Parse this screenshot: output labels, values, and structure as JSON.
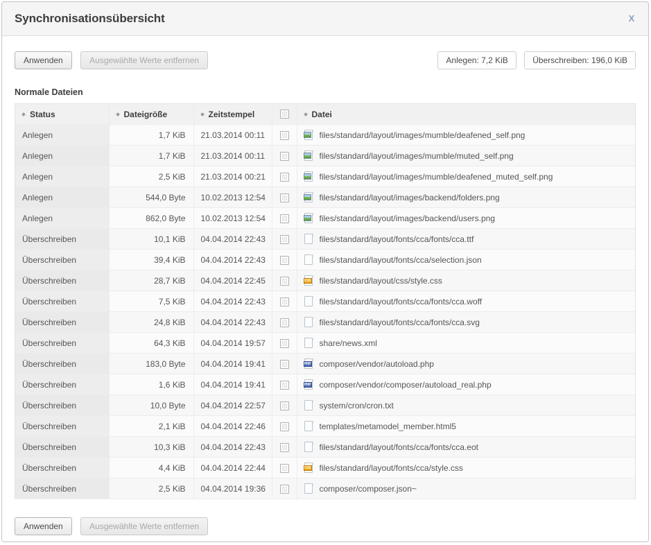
{
  "dialog": {
    "title": "Synchronisationsübersicht",
    "close_label": "X"
  },
  "toolbar": {
    "apply_label": "Anwenden",
    "remove_selected_label": "Ausgewählte Werte entfernen",
    "stat_create_label": "Anlegen: 7,2 KiB",
    "stat_overwrite_label": "Überschreiben: 196,0 KiB"
  },
  "section": {
    "title": "Normale Dateien"
  },
  "table": {
    "columns": [
      {
        "key": "status",
        "label": "Status"
      },
      {
        "key": "size",
        "label": "Dateigröße"
      },
      {
        "key": "time",
        "label": "Zeitstempel"
      },
      {
        "key": "check",
        "label": ""
      },
      {
        "key": "file",
        "label": "Datei"
      }
    ],
    "rows": [
      {
        "status": "Anlegen",
        "size": "1,7 KiB",
        "time": "21.03.2014 00:11",
        "checked": false,
        "icon": "image-file-icon",
        "file": "files/standard/layout/images/mumble/deafened_self.png"
      },
      {
        "status": "Anlegen",
        "size": "1,7 KiB",
        "time": "21.03.2014 00:11",
        "checked": false,
        "icon": "image-file-icon",
        "file": "files/standard/layout/images/mumble/muted_self.png"
      },
      {
        "status": "Anlegen",
        "size": "2,5 KiB",
        "time": "21.03.2014 00:21",
        "checked": false,
        "icon": "image-file-icon",
        "file": "files/standard/layout/images/mumble/deafened_muted_self.png"
      },
      {
        "status": "Anlegen",
        "size": "544,0 Byte",
        "time": "10.02.2013 12:54",
        "checked": false,
        "icon": "image-file-icon",
        "file": "files/standard/layout/images/backend/folders.png"
      },
      {
        "status": "Anlegen",
        "size": "862,0 Byte",
        "time": "10.02.2013 12:54",
        "checked": false,
        "icon": "image-file-icon",
        "file": "files/standard/layout/images/backend/users.png"
      },
      {
        "status": "Überschreiben",
        "size": "10,1 KiB",
        "time": "04.04.2014 22:43",
        "checked": false,
        "icon": "generic-file-icon",
        "file": "files/standard/layout/fonts/cca/fonts/cca.ttf"
      },
      {
        "status": "Überschreiben",
        "size": "39,4 KiB",
        "time": "04.04.2014 22:43",
        "checked": false,
        "icon": "generic-file-icon",
        "file": "files/standard/layout/fonts/cca/selection.json"
      },
      {
        "status": "Überschreiben",
        "size": "28,7 KiB",
        "time": "04.04.2014 22:45",
        "checked": false,
        "icon": "css-file-icon",
        "file": "files/standard/layout/css/style.css"
      },
      {
        "status": "Überschreiben",
        "size": "7,5 KiB",
        "time": "04.04.2014 22:43",
        "checked": false,
        "icon": "generic-file-icon",
        "file": "files/standard/layout/fonts/cca/fonts/cca.woff"
      },
      {
        "status": "Überschreiben",
        "size": "24,8 KiB",
        "time": "04.04.2014 22:43",
        "checked": false,
        "icon": "generic-file-icon",
        "file": "files/standard/layout/fonts/cca/fonts/cca.svg"
      },
      {
        "status": "Überschreiben",
        "size": "64,3 KiB",
        "time": "04.04.2014 19:57",
        "checked": false,
        "icon": "generic-file-icon",
        "file": "share/news.xml"
      },
      {
        "status": "Überschreiben",
        "size": "183,0 Byte",
        "time": "04.04.2014 19:41",
        "checked": false,
        "icon": "php-file-icon",
        "file": "composer/vendor/autoload.php"
      },
      {
        "status": "Überschreiben",
        "size": "1,6 KiB",
        "time": "04.04.2014 19:41",
        "checked": false,
        "icon": "php-file-icon",
        "file": "composer/vendor/composer/autoload_real.php"
      },
      {
        "status": "Überschreiben",
        "size": "10,0 Byte",
        "time": "04.04.2014 22:57",
        "checked": false,
        "icon": "generic-file-icon",
        "file": "system/cron/cron.txt"
      },
      {
        "status": "Überschreiben",
        "size": "2,1 KiB",
        "time": "04.04.2014 22:46",
        "checked": false,
        "icon": "generic-file-icon",
        "file": "templates/metamodel_member.html5"
      },
      {
        "status": "Überschreiben",
        "size": "10,3 KiB",
        "time": "04.04.2014 22:43",
        "checked": false,
        "icon": "generic-file-icon",
        "file": "files/standard/layout/fonts/cca/fonts/cca.eot"
      },
      {
        "status": "Überschreiben",
        "size": "4,4 KiB",
        "time": "04.04.2014 22:44",
        "checked": false,
        "icon": "css-file-icon",
        "file": "files/standard/layout/fonts/cca/style.css"
      },
      {
        "status": "Überschreiben",
        "size": "2,5 KiB",
        "time": "04.04.2014 19:36",
        "checked": false,
        "icon": "generic-file-icon",
        "file": "composer/composer.json~"
      }
    ]
  },
  "icon_glyphs": {
    "css-file-icon": "CSS",
    "php-file-icon": "PHP"
  },
  "colors": {
    "titlebar_bg": "#f5f5f5",
    "header_bg": "#f1f1f1",
    "status_col_bg": "#ededed",
    "close_icon": "#8ba2bd",
    "css_badge": "#f0a30a",
    "php_badge": "#5070b8"
  }
}
